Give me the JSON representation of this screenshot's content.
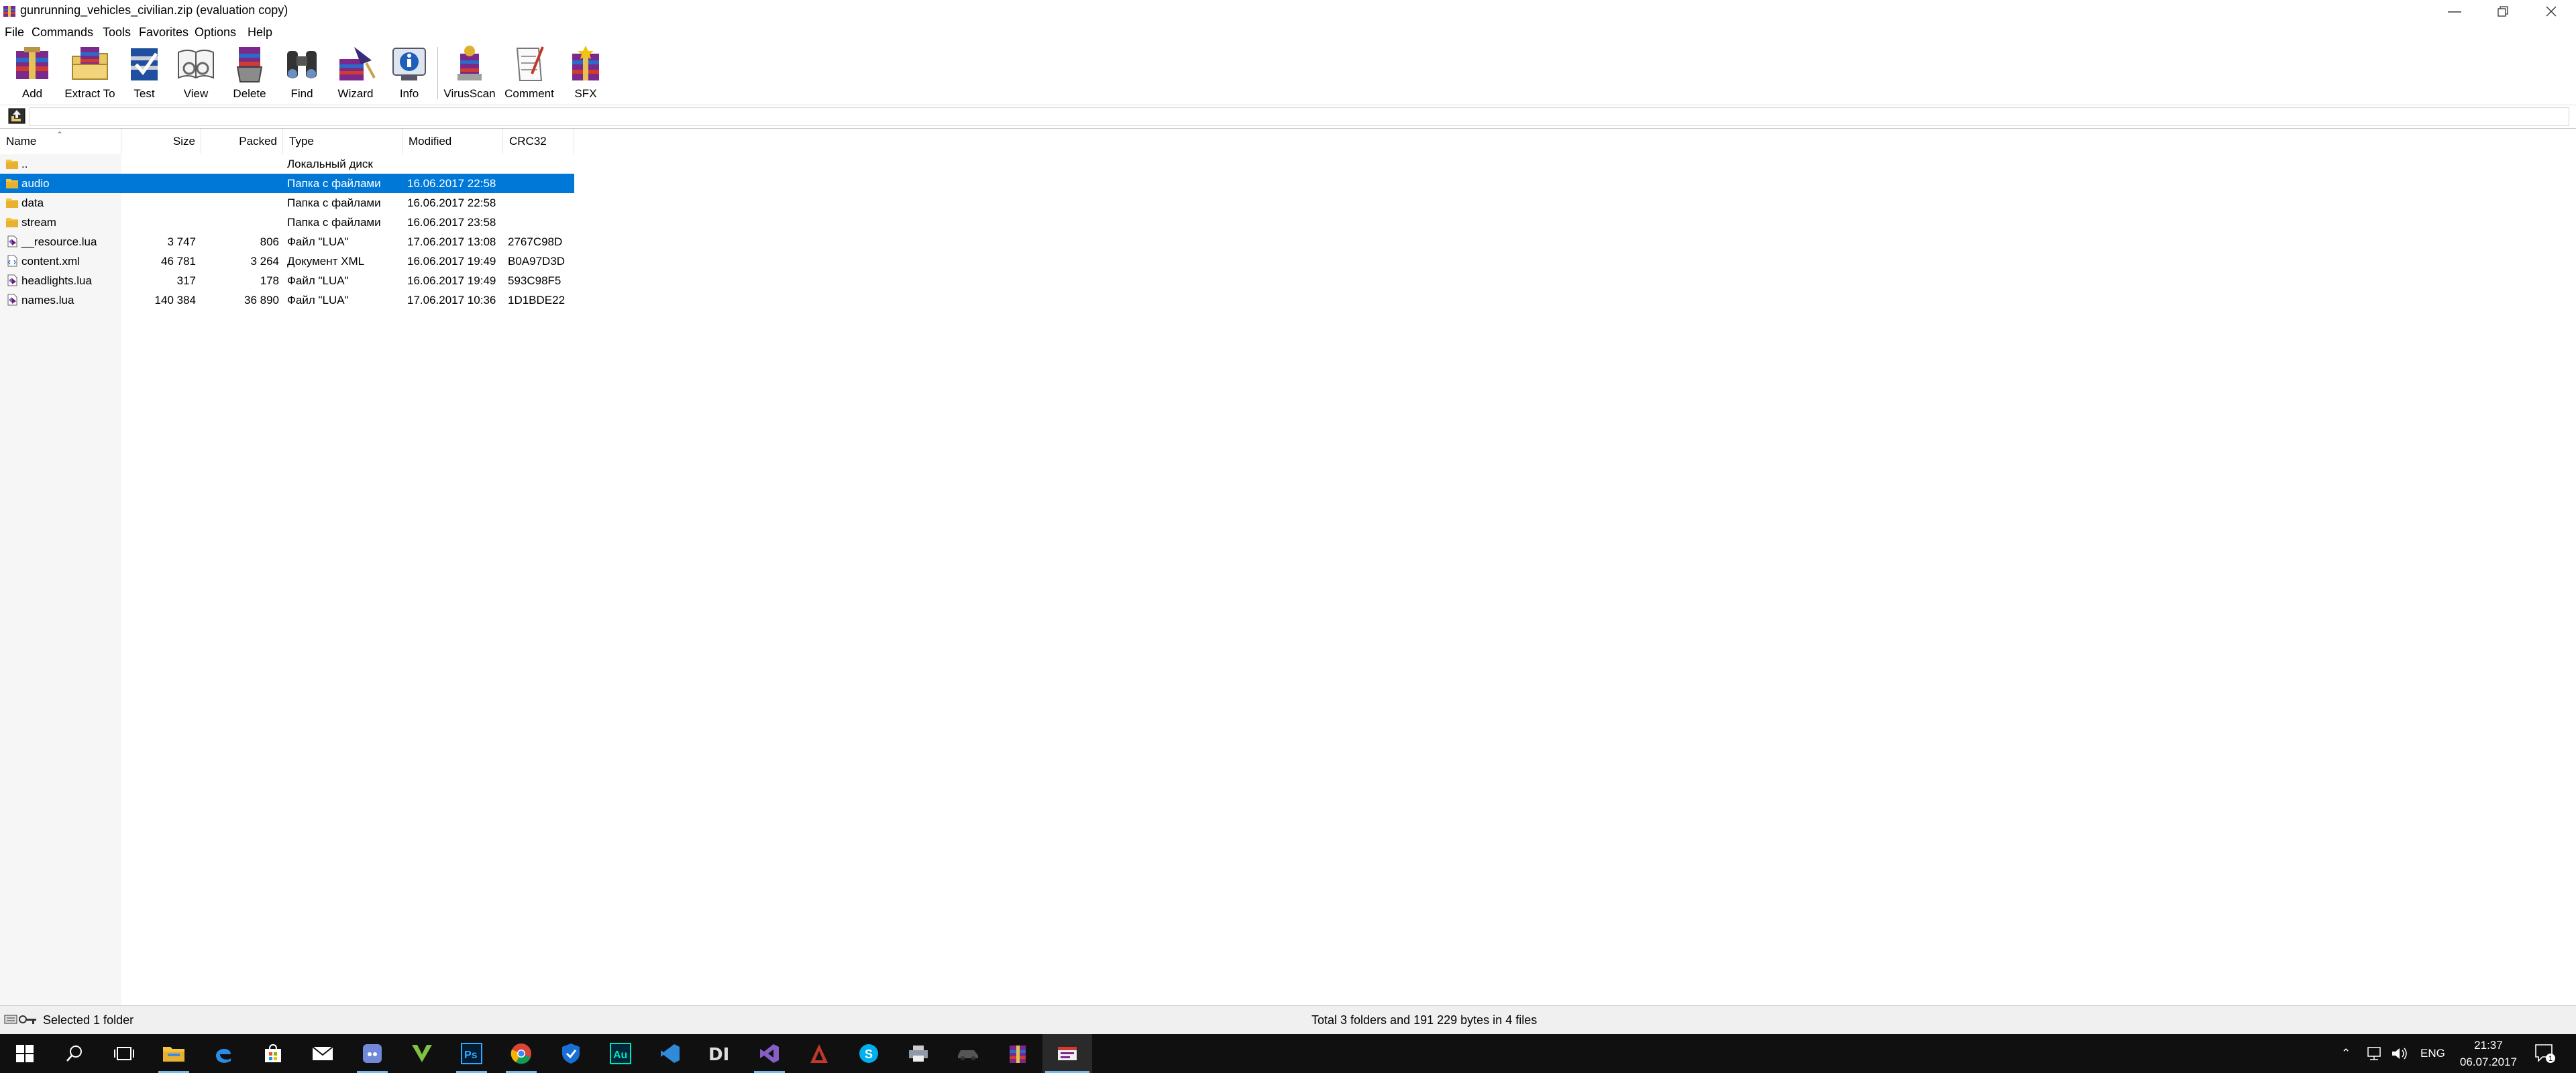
{
  "window": {
    "title": "gunrunning_vehicles_civilian.zip (evaluation copy)",
    "controls": [
      "minimize",
      "restore",
      "close"
    ]
  },
  "menu": [
    "File",
    "Commands",
    "Tools",
    "Favorites",
    "Options",
    "Help"
  ],
  "toolbar": [
    "Add",
    "Extract To",
    "Test",
    "View",
    "Delete",
    "Find",
    "Wizard",
    "Info",
    "VirusScan",
    "Comment",
    "SFX"
  ],
  "columns": {
    "name": "Name",
    "size": "Size",
    "packed": "Packed",
    "type": "Type",
    "modified": "Modified",
    "crc": "CRC32"
  },
  "files": [
    {
      "name": "..",
      "size": "",
      "packed": "",
      "type": "Локальный диск",
      "modified": "",
      "crc": "",
      "kind": "folder",
      "selected": false
    },
    {
      "name": "audio",
      "size": "",
      "packed": "",
      "type": "Папка с файлами",
      "modified": "16.06.2017 22:58",
      "crc": "",
      "kind": "folder",
      "selected": true
    },
    {
      "name": "data",
      "size": "",
      "packed": "",
      "type": "Папка с файлами",
      "modified": "16.06.2017 22:58",
      "crc": "",
      "kind": "folder",
      "selected": false
    },
    {
      "name": "stream",
      "size": "",
      "packed": "",
      "type": "Папка с файлами",
      "modified": "16.06.2017 23:58",
      "crc": "",
      "kind": "folder",
      "selected": false
    },
    {
      "name": "__resource.lua",
      "size": "3 747",
      "packed": "806",
      "type": "Файл \"LUA\"",
      "modified": "17.06.2017 13:08",
      "crc": "2767C98D",
      "kind": "lua",
      "selected": false
    },
    {
      "name": "content.xml",
      "size": "46 781",
      "packed": "3 264",
      "type": "Документ XML",
      "modified": "16.06.2017 19:49",
      "crc": "B0A97D3D",
      "kind": "xml",
      "selected": false
    },
    {
      "name": "headlights.lua",
      "size": "317",
      "packed": "178",
      "type": "Файл \"LUA\"",
      "modified": "16.06.2017 19:49",
      "crc": "593C98F5",
      "kind": "lua",
      "selected": false
    },
    {
      "name": "names.lua",
      "size": "140 384",
      "packed": "36 890",
      "type": "Файл \"LUA\"",
      "modified": "17.06.2017 10:36",
      "crc": "1D1BDE22",
      "kind": "lua",
      "selected": false
    }
  ],
  "status": {
    "left": "Selected 1 folder",
    "right": "Total 3 folders and 191 229 bytes in 4 files"
  },
  "taskbar": {
    "apps": [
      "windows-start",
      "search",
      "task-view",
      "file-explorer",
      "edge",
      "store",
      "mail",
      "discord",
      "gta-v",
      "photoshop",
      "chrome",
      "security",
      "audition",
      "visual-studio-code",
      "daz",
      "visual-studio",
      "adobe-flame",
      "skype",
      "printer",
      "car",
      "archive",
      "winrar"
    ],
    "language": "ENG",
    "time": "21:37",
    "date": "06.07.2017",
    "notifications": "1"
  },
  "colors": {
    "selection": "#0078d7",
    "taskbar": "#101010",
    "status": "#f0f0f0"
  }
}
